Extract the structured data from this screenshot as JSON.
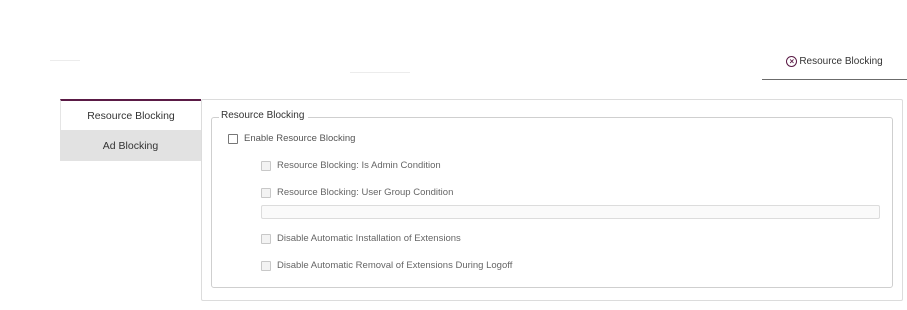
{
  "top_tab": {
    "label": "Resource Blocking",
    "icon": "close-circle-icon"
  },
  "side_tabs": [
    {
      "label": "Resource Blocking",
      "active": true
    },
    {
      "label": "Ad Blocking",
      "active": false
    }
  ],
  "group": {
    "legend": "Resource Blocking",
    "enable": {
      "label": "Enable Resource Blocking",
      "checked": false
    },
    "options": [
      {
        "label": "Resource Blocking: Is Admin Condition",
        "checked": false,
        "disabled": true
      },
      {
        "label": "Resource Blocking: User Group Condition",
        "checked": false,
        "disabled": true
      },
      {
        "label": "Disable Automatic Installation of Extensions",
        "checked": false,
        "disabled": true
      },
      {
        "label": "Disable Automatic Removal of Extensions During Logoff",
        "checked": false,
        "disabled": true
      }
    ],
    "user_group_input": {
      "value": "",
      "placeholder": ""
    }
  },
  "colors": {
    "accent": "#5a1a45",
    "inactive_tab": "#e2e2e2"
  }
}
